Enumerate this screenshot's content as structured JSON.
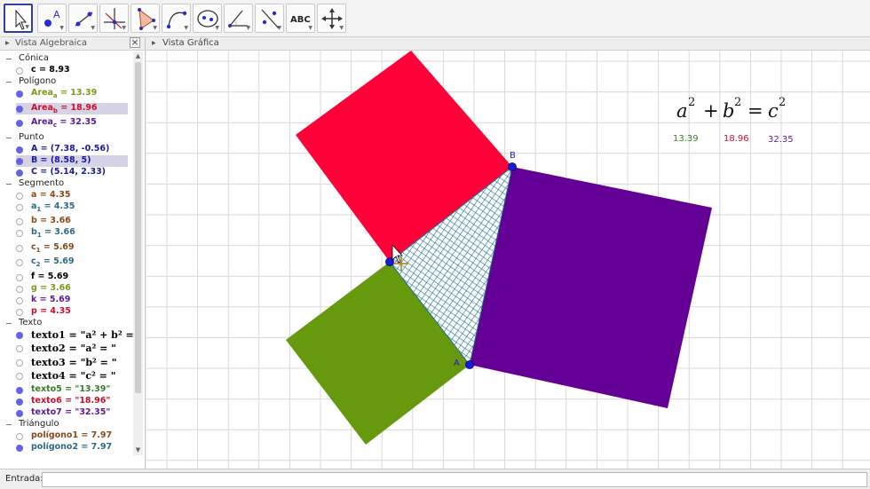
{
  "toolbar": {
    "tools": [
      {
        "name": "move",
        "icon": "cursor-arrow-icon",
        "active": true
      },
      {
        "name": "point",
        "icon": "point-icon",
        "label": "A"
      },
      {
        "name": "line",
        "icon": "line-icon"
      },
      {
        "name": "perpendicular",
        "icon": "perpendicular-icon"
      },
      {
        "name": "polygon",
        "icon": "polygon-icon"
      },
      {
        "name": "arc",
        "icon": "arc-icon"
      },
      {
        "name": "conic",
        "icon": "ellipse-icon"
      },
      {
        "name": "angle",
        "icon": "angle-icon"
      },
      {
        "name": "reflect",
        "icon": "reflect-icon"
      },
      {
        "name": "text",
        "icon": "text-icon",
        "label": "ABC"
      },
      {
        "name": "move-view",
        "icon": "move-view-icon"
      }
    ]
  },
  "algebra": {
    "title": "Vista Algebraica",
    "groups": [
      {
        "label": "Cónica",
        "items": [
          {
            "text": "c = 8.93",
            "color": "#000000",
            "visible": false
          }
        ]
      },
      {
        "label": "Polígono",
        "items": [
          {
            "text": "Area",
            "sub": "a",
            "rest": " = 13.39",
            "color": "#7a9a1a",
            "visible": true
          },
          {
            "text": "Area",
            "sub": "b",
            "rest": " = 18.96",
            "color": "#c8102e",
            "visible": true,
            "selected": true
          },
          {
            "text": "Area",
            "sub": "c",
            "rest": " = 32.35",
            "color": "#5b1a9a",
            "visible": true
          }
        ]
      },
      {
        "label": "Punto",
        "items": [
          {
            "text": "A = (7.38, -0.56)",
            "color": "#1a1aa0",
            "visible": true
          },
          {
            "text": "B = (8.58, 5)",
            "color": "#1a1aa0",
            "visible": true,
            "selected": true
          },
          {
            "text": "C = (5.14, 2.33)",
            "color": "#1a1aa0",
            "visible": true
          }
        ]
      },
      {
        "label": "Segmento",
        "items": [
          {
            "text": "a = 4.35",
            "color": "#8a4a1a",
            "visible": false
          },
          {
            "text": "a",
            "sub": "1",
            "rest": " = 4.35",
            "color": "#2a6a8a",
            "visible": false
          },
          {
            "text": "b = 3.66",
            "color": "#8a4a1a",
            "visible": false
          },
          {
            "text": "b",
            "sub": "1",
            "rest": " = 3.66",
            "color": "#2a6a8a",
            "visible": false
          },
          {
            "text": "c",
            "sub": "1",
            "rest": " = 5.69",
            "color": "#8a4a1a",
            "visible": false
          },
          {
            "text": "c",
            "sub": "2",
            "rest": " = 5.69",
            "color": "#2a6a8a",
            "visible": false
          },
          {
            "text": "f = 5.69",
            "color": "#000000",
            "visible": false
          },
          {
            "text": "g = 3.66",
            "color": "#7a9a1a",
            "visible": false
          },
          {
            "text": "k = 5.69",
            "color": "#5b1a9a",
            "visible": false
          },
          {
            "text": "p = 4.35",
            "color": "#c8102e",
            "visible": false
          }
        ]
      },
      {
        "label": "Texto",
        "items": [
          {
            "text": "texto1 =  \"a² + b² =",
            "color": "#000000",
            "visible": true,
            "big": true
          },
          {
            "text": "texto2 =  \"a² = \"",
            "color": "#000000",
            "visible": false,
            "big": true
          },
          {
            "text": "texto3 =  \"b² = \"",
            "color": "#000000",
            "visible": false,
            "big": true
          },
          {
            "text": "texto4 =  \"c² = \"",
            "color": "#000000",
            "visible": false,
            "big": true
          },
          {
            "text": "texto5 = \"13.39\"",
            "color": "#3a7a2a",
            "visible": true
          },
          {
            "text": "texto6 = \"18.96\"",
            "color": "#c8102e",
            "visible": true
          },
          {
            "text": "texto7 = \"32.35\"",
            "color": "#5b1a9a",
            "visible": true
          }
        ]
      },
      {
        "label": "Triángulo",
        "items": [
          {
            "text": "polígono1 = 7.97",
            "color": "#8a4a1a",
            "visible": false
          },
          {
            "text": "polígono2 = 7.97",
            "color": "#2a6a8a",
            "visible": true
          }
        ]
      }
    ]
  },
  "graphics": {
    "title": "Vista Gráfica",
    "equation": {
      "a": "a",
      "b": "b",
      "c": "c",
      "exp": "2",
      "plus": "+",
      "equals": "="
    },
    "areas": [
      {
        "label": "13.39",
        "color": "#3a7a2a"
      },
      {
        "label": "18.96",
        "color": "#c8102e"
      },
      {
        "label": "32.35",
        "color": "#5b1a9a"
      }
    ],
    "point_labels": {
      "A": "A",
      "B": "B"
    },
    "colors": {
      "square_a": "#66990d",
      "square_b": "#ff0038",
      "square_c": "#640096",
      "triangle": "#1c6e8c",
      "point": "#1a1ad8",
      "grid": "#d9d9d9"
    }
  },
  "input": {
    "label": "Entrada:",
    "value": ""
  }
}
